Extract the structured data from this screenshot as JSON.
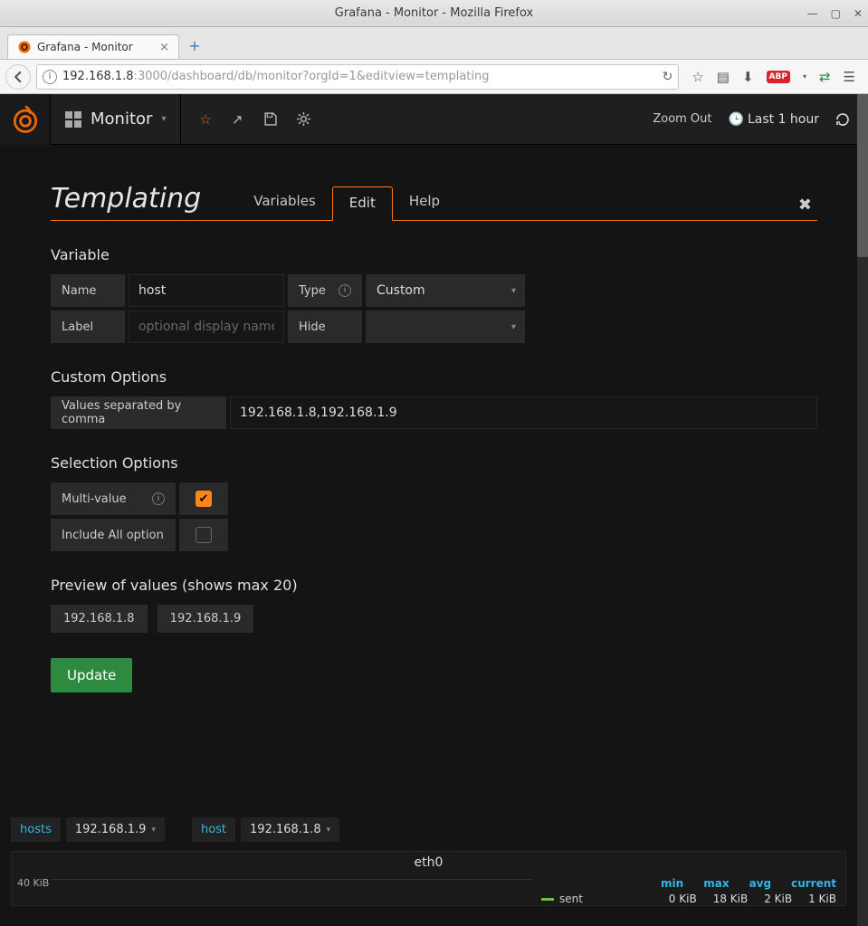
{
  "window": {
    "title": "Grafana - Monitor - Mozilla Firefox"
  },
  "browser": {
    "tab_title": "Grafana - Monitor",
    "url_host": "192.168.1.8",
    "url_path": ":3000/dashboard/db/monitor?orgId=1&editview=templating"
  },
  "header": {
    "dashboard_name": "Monitor",
    "zoom_label": "Zoom Out",
    "time_label": "Last 1 hour"
  },
  "templating": {
    "title": "Templating",
    "tabs": {
      "variables": "Variables",
      "edit": "Edit",
      "help": "Help"
    },
    "variable_section": "Variable",
    "name_label": "Name",
    "name_value": "host",
    "type_label": "Type",
    "type_value": "Custom",
    "label_label": "Label",
    "label_placeholder": "optional display name",
    "hide_label": "Hide",
    "hide_value": "",
    "custom_section": "Custom Options",
    "values_label": "Values separated by comma",
    "values_value": "192.168.1.8,192.168.1.9",
    "selection_section": "Selection Options",
    "multi_label": "Multi-value",
    "include_all_label": "Include All option",
    "preview_section": "Preview of values (shows max 20)",
    "preview": [
      "192.168.1.8",
      "192.168.1.9"
    ],
    "update_btn": "Update"
  },
  "vars": {
    "hosts_name": "hosts",
    "hosts_value": "192.168.1.9",
    "host_name": "host",
    "host_value": "192.168.1.8"
  },
  "panel": {
    "title": "eth0",
    "yaxis_tick": "40 KiB",
    "legend": {
      "headers": [
        "min",
        "max",
        "avg",
        "current"
      ],
      "series_name": "sent",
      "values": [
        "0 KiB",
        "18 KiB",
        "2 KiB",
        "1 KiB"
      ]
    }
  }
}
